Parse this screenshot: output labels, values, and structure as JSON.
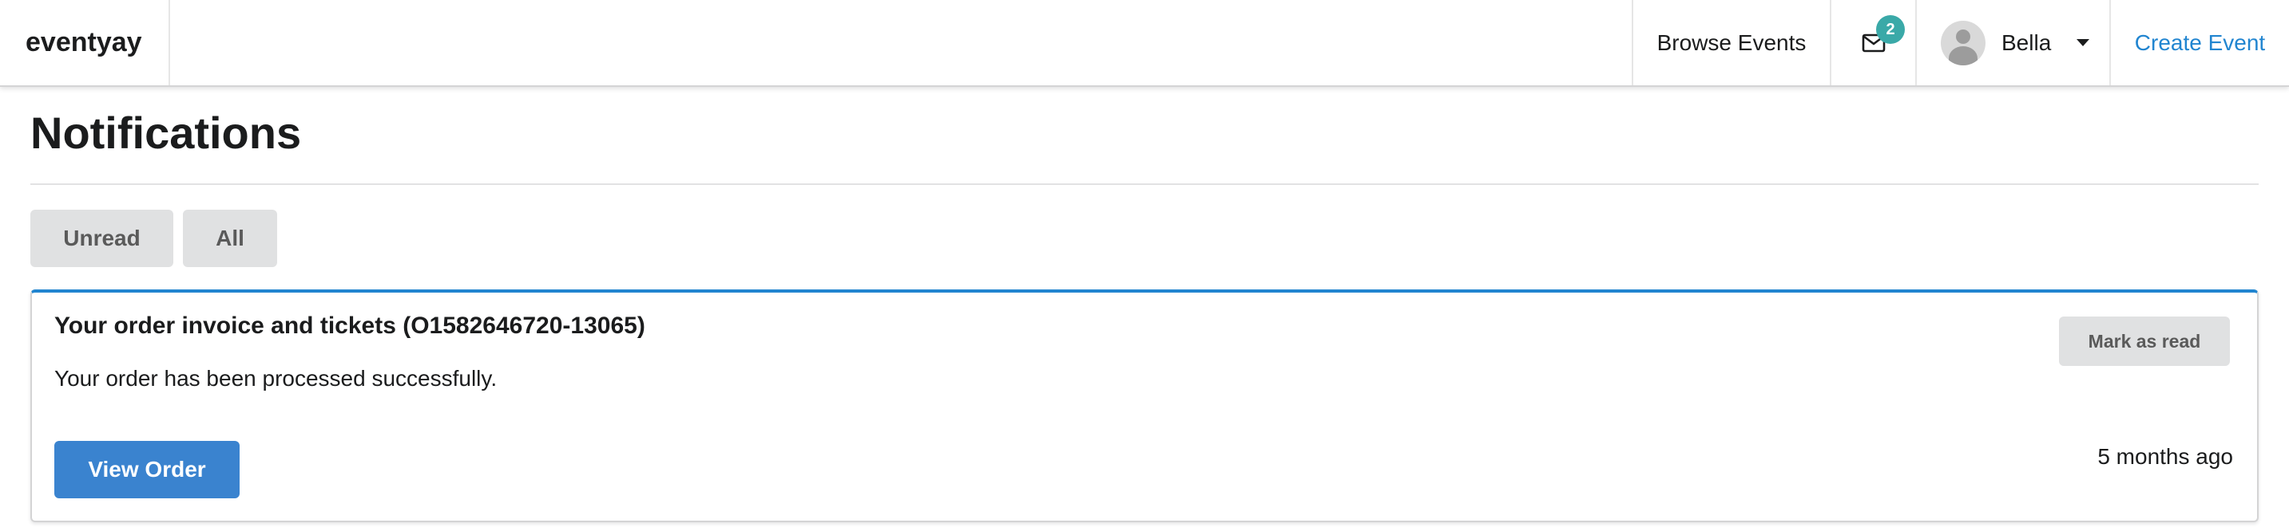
{
  "nav": {
    "brand": "eventyay",
    "browse_events": "Browse Events",
    "mail_icon": "envelope-icon",
    "mail_count": "2",
    "user_name": "Bella",
    "create_event": "Create Event"
  },
  "page": {
    "title": "Notifications"
  },
  "filters": {
    "unread": "Unread",
    "all": "All"
  },
  "notification": {
    "title": "Your order invoice and tickets (O1582646720-13065)",
    "description": "Your order has been processed successfully.",
    "mark_read_label": "Mark as read",
    "action_label": "View Order",
    "timestamp": "5 months ago"
  },
  "colors": {
    "accent": "#2185d0",
    "primary_button": "#3a83cf",
    "badge": "#3aa9a8",
    "secondary_button": "#e0e1e2"
  }
}
